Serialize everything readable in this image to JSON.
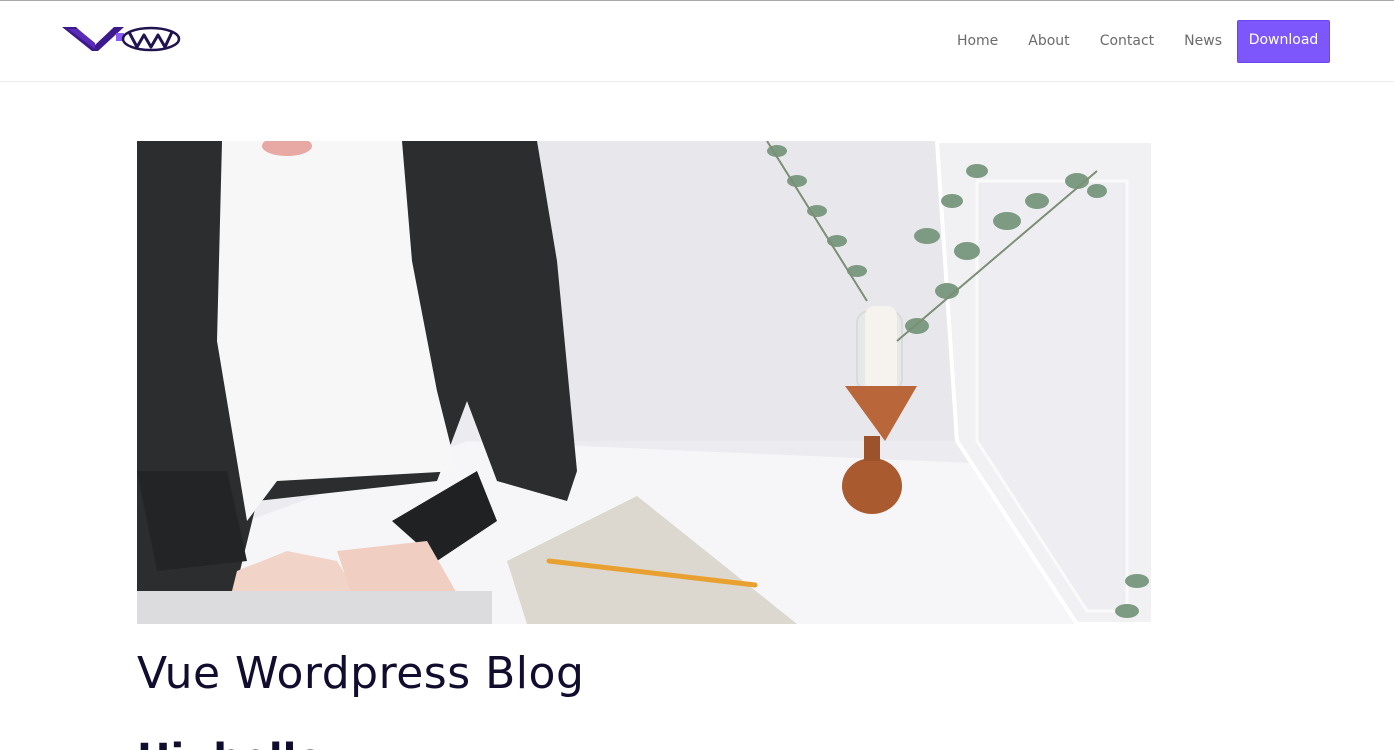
{
  "header": {
    "logo_text": "VW",
    "nav": [
      {
        "label": "Home"
      },
      {
        "label": "About"
      },
      {
        "label": "Contact"
      },
      {
        "label": "News"
      }
    ],
    "download_label": "Download"
  },
  "main": {
    "hero_image": "woman-at-desk-with-plant-and-notebook",
    "title": "Vue Wordpress Blog",
    "subheading": "Hi, hello"
  },
  "colors": {
    "accent": "#7d57fb",
    "title": "#110d2e",
    "nav_text": "#6b6b6b"
  }
}
